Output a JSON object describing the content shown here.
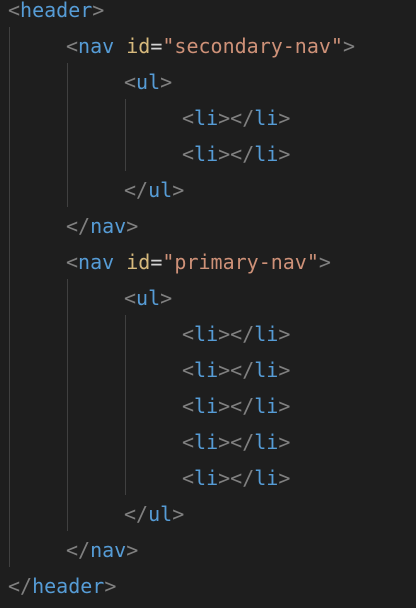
{
  "theme": {
    "background": "#1e1e1e",
    "tag_color": "#569cd6",
    "bracket_color": "#808080",
    "attribute_color": "#d7ba7d",
    "string_color": "#ce9178",
    "guide_color": "#404040"
  },
  "code": {
    "l1": {
      "open": "<",
      "name": "header",
      "close": ">"
    },
    "l2": {
      "open": "<",
      "name": "nav",
      "attr": "id",
      "eq": "=",
      "value": "\"secondary-nav\"",
      "close": ">"
    },
    "l3": {
      "open": "<",
      "name": "ul",
      "close": ">"
    },
    "l4": {
      "open1": "<",
      "name1": "li",
      "mid": "></",
      "name2": "li",
      "close": ">"
    },
    "l5": {
      "open1": "<",
      "name1": "li",
      "mid": "></",
      "name2": "li",
      "close": ">"
    },
    "l6": {
      "open": "</",
      "name": "ul",
      "close": ">"
    },
    "l7": {
      "open": "</",
      "name": "nav",
      "close": ">"
    },
    "l8": {
      "open": "<",
      "name": "nav",
      "attr": "id",
      "eq": "=",
      "value": "\"primary-nav\"",
      "close": ">"
    },
    "l9": {
      "open": "<",
      "name": "ul",
      "close": ">"
    },
    "l10": {
      "open1": "<",
      "name1": "li",
      "mid": "></",
      "name2": "li",
      "close": ">"
    },
    "l11": {
      "open1": "<",
      "name1": "li",
      "mid": "></",
      "name2": "li",
      "close": ">"
    },
    "l12": {
      "open1": "<",
      "name1": "li",
      "mid": "></",
      "name2": "li",
      "close": ">"
    },
    "l13": {
      "open1": "<",
      "name1": "li",
      "mid": "></",
      "name2": "li",
      "close": ">"
    },
    "l14": {
      "open1": "<",
      "name1": "li",
      "mid": "></",
      "name2": "li",
      "close": ">"
    },
    "l15": {
      "open": "</",
      "name": "ul",
      "close": ">"
    },
    "l16": {
      "open": "</",
      "name": "nav",
      "close": ">"
    },
    "l17": {
      "open": "</",
      "name": "header",
      "close": ">"
    }
  }
}
